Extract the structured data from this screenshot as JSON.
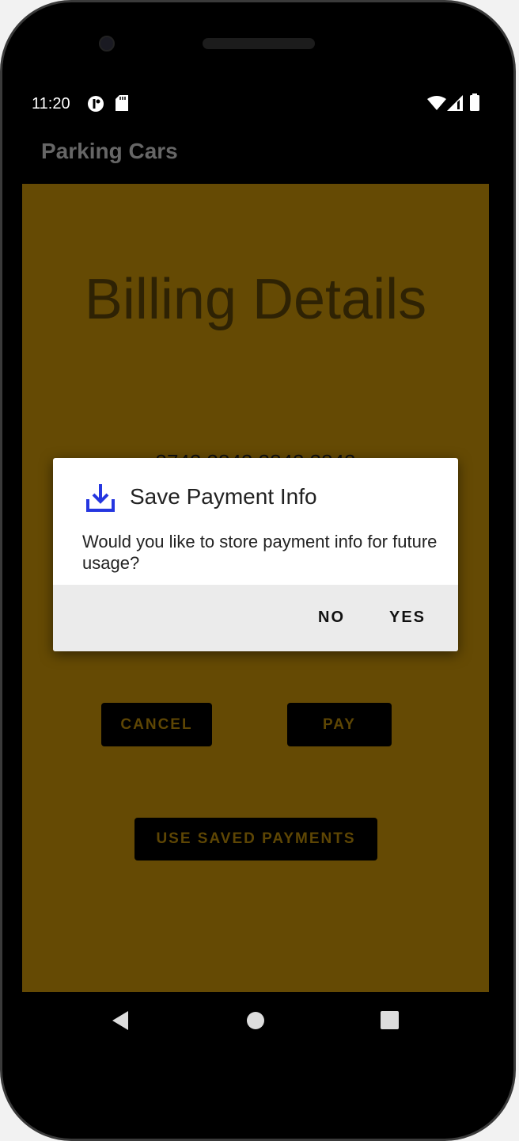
{
  "status_bar": {
    "time": "11:20",
    "icons": [
      "data-saver-icon",
      "sd-card-icon",
      "wifi-icon",
      "signal-icon",
      "battery-icon"
    ]
  },
  "app_bar": {
    "title": "Parking Cars"
  },
  "main": {
    "title": "Billing Details",
    "card_number": "3742 3842 3842 3842",
    "cancel_label": "CANCEL",
    "pay_label": "PAY",
    "saved_label": "USE SAVED PAYMENTS"
  },
  "dialog": {
    "icon": "download-icon",
    "title": "Save Payment Info",
    "message": "Would you like to store payment info for future usage?",
    "no_label": "NO",
    "yes_label": "YES"
  },
  "nav_bar": {
    "icons": [
      "back-icon",
      "home-icon",
      "recents-icon"
    ]
  },
  "colors": {
    "content_bg": "#654a04",
    "dialog_icon": "#2536e0"
  }
}
